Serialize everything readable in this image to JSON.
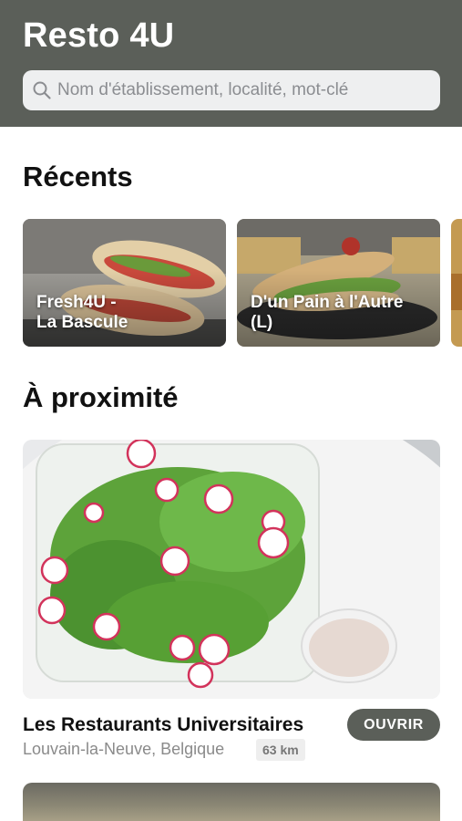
{
  "header": {
    "title": "Resto 4U",
    "search_placeholder": "Nom d'établissement, localité, mot-clé"
  },
  "recent": {
    "title": "Récents",
    "items": [
      {
        "label": "Fresh4U -\nLa Bascule"
      },
      {
        "label": "D'un Pain à l'Autre\n(L)"
      }
    ]
  },
  "nearby": {
    "title": "À proximité",
    "items": [
      {
        "name": "Les Restaurants Universitaires",
        "location": "Louvain-la-Neuve, Belgique",
        "distance": "63 km",
        "action_label": "OUVRIR"
      }
    ]
  },
  "colors": {
    "header_bg": "#5b5f59",
    "button_bg": "#5b5f59",
    "search_bg": "#eeeff0"
  },
  "icons": [
    "search-icon"
  ]
}
